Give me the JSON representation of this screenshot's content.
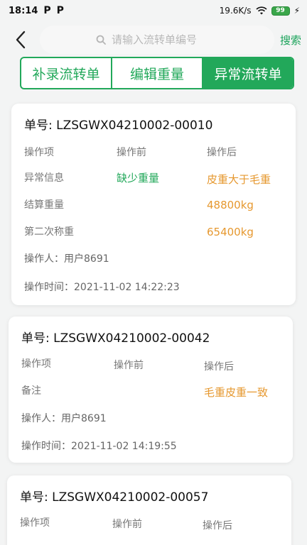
{
  "status_bar": {
    "time": "18:14",
    "app_icon_1": "P",
    "app_icon_2": "P",
    "net_speed": "19.6K/s",
    "battery": "99",
    "bolt": "⚡"
  },
  "header": {
    "search_placeholder": "请输入流转单编号",
    "search_label": "搜索"
  },
  "tabs": [
    {
      "label": "补录流转单",
      "active": false
    },
    {
      "label": "编辑重量",
      "active": false
    },
    {
      "label": "异常流转单",
      "active": true
    }
  ],
  "colors": {
    "accent": "#22a85a",
    "warning": "#e6982f"
  },
  "cards": [
    {
      "order_label": "单号:",
      "order_no": "LZSGWX04210002-00010",
      "col_item": "操作项",
      "col_before": "操作前",
      "col_after": "操作后",
      "rows": [
        {
          "item": "异常信息",
          "before": "缺少重量",
          "after": "皮重大于毛重"
        },
        {
          "item": "结算重量",
          "before": "",
          "after": "48800kg"
        },
        {
          "item": "第二次称重",
          "before": "",
          "after": "65400kg"
        }
      ],
      "operator": "操作人：用户8691",
      "time": "操作时间：2021-11-02 14:22:23"
    },
    {
      "order_label": "单号:",
      "order_no": "LZSGWX04210002-00042",
      "col_item": "操作项",
      "col_before": "操作前",
      "col_after": "操作后",
      "rows": [
        {
          "item": "备注",
          "before": "",
          "after": "毛重皮重一致"
        }
      ],
      "operator": "操作人：用户8691",
      "time": "操作时间：2021-11-02 14:19:55"
    },
    {
      "order_label": "单号:",
      "order_no": "LZSGWX04210002-00057",
      "col_item": "操作项",
      "col_before": "操作前",
      "col_after": "操作后"
    }
  ]
}
